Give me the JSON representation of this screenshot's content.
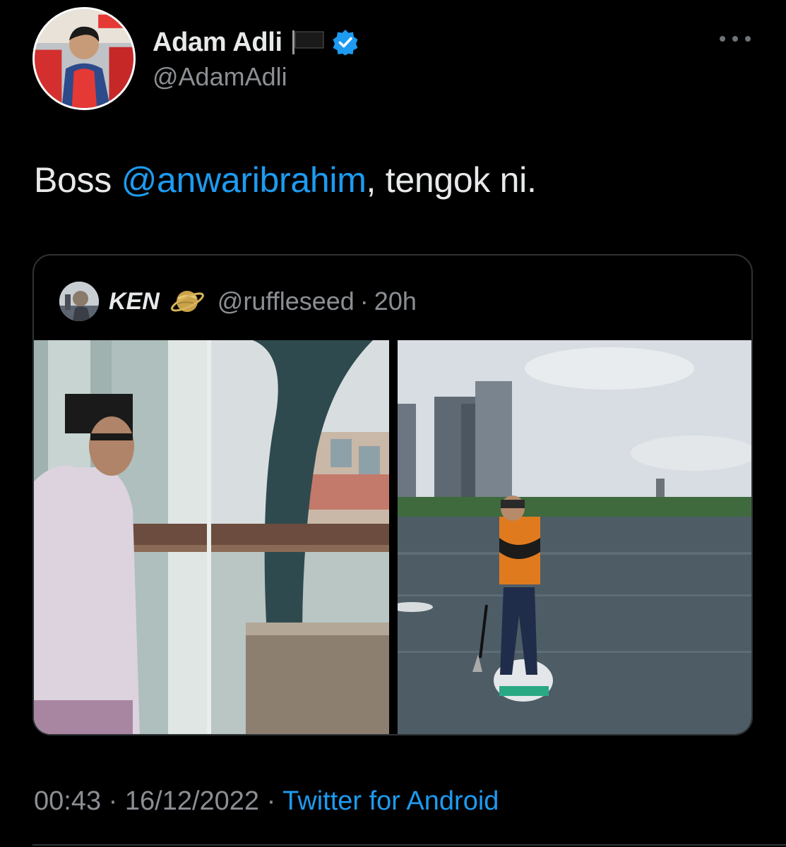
{
  "tweet": {
    "author": {
      "display_name": "Adam Adli",
      "handle": "@AdamAdli",
      "avatar": "profile-photo",
      "flag": "black-flag-icon",
      "verified": true
    },
    "text_before": "Boss ",
    "mention": "@anwaribrahim",
    "text_after": ", tengok ni.",
    "quoted": {
      "display_name": "KEN",
      "emoji": "ringed-planet-icon",
      "handle": "@ruffleseed",
      "separator": "·",
      "time": "20h",
      "photos": [
        "man-in-songkok-by-window",
        "man-paddleboarding-on-lake"
      ]
    },
    "meta": {
      "time": "00:43",
      "separator_1": "·",
      "date": "16/12/2022",
      "separator_2": "·",
      "source": "Twitter for Android"
    }
  },
  "colors": {
    "background": "#000000",
    "text": "#e7e9ea",
    "secondary": "#8b8f94",
    "accent": "#1d9bf0",
    "border": "#2f3336"
  }
}
